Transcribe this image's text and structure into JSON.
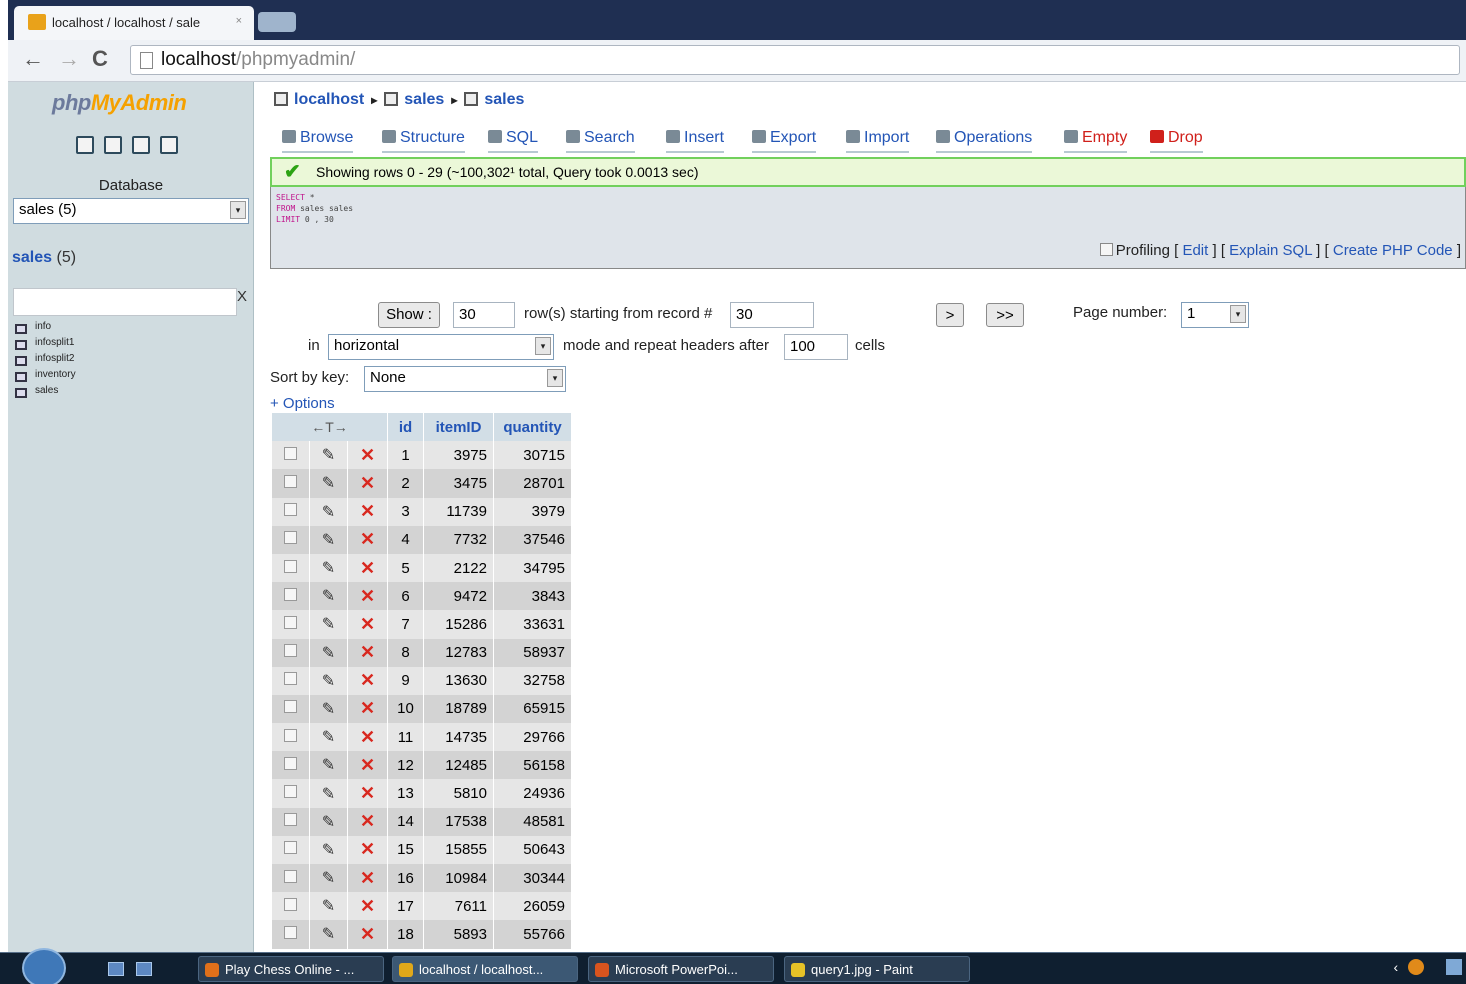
{
  "browser": {
    "tab_title": "localhost / localhost / sale",
    "tab_close": "×",
    "back_icon": "←",
    "forward_icon": "→",
    "reload_icon": "C",
    "address_host": "localhost",
    "address_path": "/phpmyadmin/"
  },
  "sidebar": {
    "logo_part1": "php",
    "logo_part2": "MyAdmin",
    "database_label": "Database",
    "database_select": "sales (5)",
    "db_link_name": "sales",
    "db_link_count": "(5)",
    "filter_clear": "X",
    "tables": [
      "info",
      "infosplit1",
      "infosplit2",
      "inventory",
      "sales"
    ]
  },
  "breadcrumb": {
    "server": "localhost",
    "database": "sales",
    "table": "sales",
    "sep": "▸"
  },
  "tabs": [
    {
      "label": "Browse",
      "color": "#2355b6"
    },
    {
      "label": "Structure",
      "color": "#2355b6"
    },
    {
      "label": "SQL",
      "color": "#2355b6"
    },
    {
      "label": "Search",
      "color": "#2355b6"
    },
    {
      "label": "Insert",
      "color": "#2355b6"
    },
    {
      "label": "Export",
      "color": "#2355b6"
    },
    {
      "label": "Import",
      "color": "#2355b6"
    },
    {
      "label": "Operations",
      "color": "#2355b6"
    },
    {
      "label": "Empty",
      "color": "#d0201b"
    },
    {
      "label": "Drop",
      "color": "#d0201b"
    }
  ],
  "message": {
    "check": "✔",
    "text": "Showing rows 0 - 29 (~100,302¹ total, Query took 0.0013 sec)"
  },
  "sql": {
    "line1_kw": "SELECT",
    "line1_rest": " *",
    "line2_kw": "FROM",
    "line2_rest": " sales sales",
    "line3_kw": "LIMIT",
    "line3_rest": " 0 , 30",
    "profiling_label": "Profiling",
    "bracket_open": "[",
    "bracket_close": "]",
    "link_edit": "Edit",
    "link_explain": "Explain SQL",
    "link_php": "Create PHP Code"
  },
  "controls": {
    "show_button": "Show :",
    "rows_value": "30",
    "rows_label": "row(s) starting from record #",
    "start_value": "30",
    "next_button": ">",
    "last_button": ">>",
    "page_label": "Page number:",
    "page_value": "1",
    "in_label": "in",
    "mode_value": "horizontal",
    "mode_label": "mode and repeat headers after",
    "repeat_value": "100",
    "cells_label": "cells",
    "sort_label": "Sort by key:",
    "sort_value": "None",
    "options_link": "+ Options",
    "select_arrow": "▾"
  },
  "table": {
    "arrows_header": "←T→",
    "columns": [
      "id",
      "itemID",
      "quantity"
    ],
    "edit_icon": "✎",
    "delete_icon": "✕",
    "rows": [
      [
        "1",
        "3975",
        "30715"
      ],
      [
        "2",
        "3475",
        "28701"
      ],
      [
        "3",
        "11739",
        "3979"
      ],
      [
        "4",
        "7732",
        "37546"
      ],
      [
        "5",
        "2122",
        "34795"
      ],
      [
        "6",
        "9472",
        "3843"
      ],
      [
        "7",
        "15286",
        "33631"
      ],
      [
        "8",
        "12783",
        "58937"
      ],
      [
        "9",
        "13630",
        "32758"
      ],
      [
        "10",
        "18789",
        "65915"
      ],
      [
        "11",
        "14735",
        "29766"
      ],
      [
        "12",
        "12485",
        "56158"
      ],
      [
        "13",
        "5810",
        "24936"
      ],
      [
        "14",
        "17538",
        "48581"
      ],
      [
        "15",
        "15855",
        "50643"
      ],
      [
        "16",
        "10984",
        "30344"
      ],
      [
        "17",
        "7611",
        "26059"
      ],
      [
        "18",
        "5893",
        "55766"
      ]
    ]
  },
  "taskbar": {
    "items": [
      {
        "label": "Play Chess Online - ...",
        "color": "#e0701a"
      },
      {
        "label": "localhost / localhost...",
        "color": "#e0a81a"
      },
      {
        "label": "Microsoft PowerPoi...",
        "color": "#d9541e"
      },
      {
        "label": "query1.jpg - Paint",
        "color": "#e6c227"
      }
    ],
    "tray_text": "‹"
  }
}
